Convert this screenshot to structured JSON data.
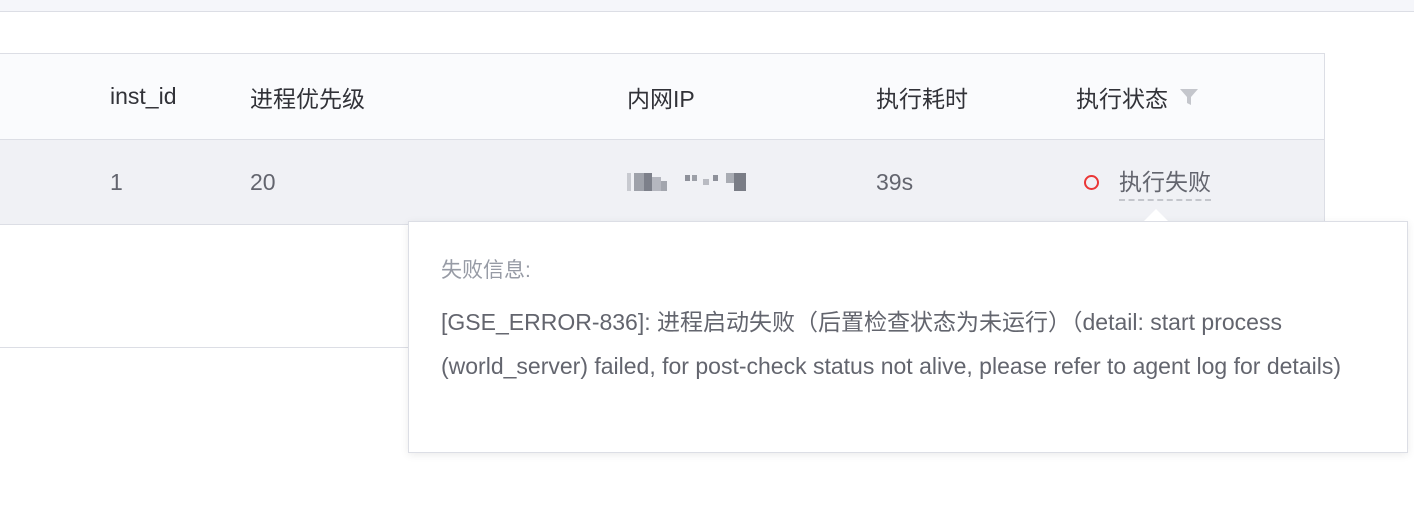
{
  "table": {
    "columns": {
      "inst_id": "inst_id",
      "priority": "进程优先级",
      "ip": "内网IP",
      "duration": "执行耗时",
      "status": "执行状态"
    },
    "rows": [
      {
        "inst_id": "1",
        "priority": "20",
        "ip": "",
        "duration": "39s",
        "status": "执行失败"
      }
    ]
  },
  "icons": {
    "status_filter": "filter-icon",
    "status_indicator": "status-dot-icon"
  },
  "colors": {
    "failed": "#ea3636",
    "header_bg": "#fafbfd",
    "row_bg": "#f0f1f5"
  },
  "tooltip": {
    "title": "失败信息:",
    "message": "[GSE_ERROR-836]: 进程启动失败（后置检查状态为未运行）（detail: start process (world_server) failed, for post-check status not alive, please refer to agent log for details)"
  }
}
